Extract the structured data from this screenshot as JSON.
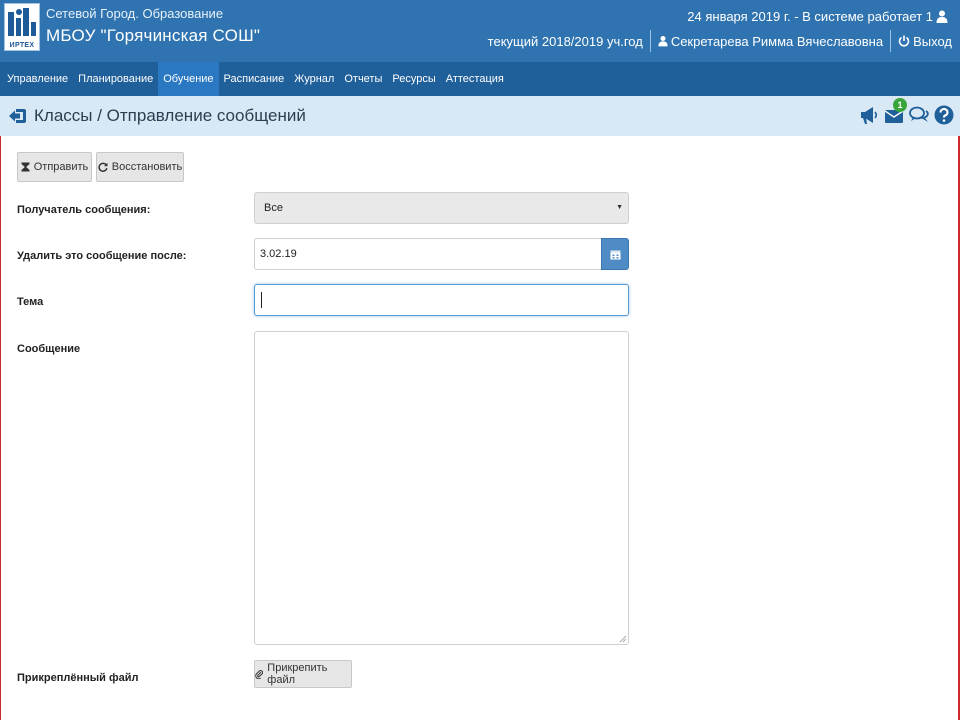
{
  "header": {
    "logo_text": "ИРТЕХ",
    "app_name": "Сетевой Город. Образование",
    "school_name": "МБОУ \"Горячинская СОШ\"",
    "date_status": "24 января 2019 г. - В системе работает 1",
    "school_year": "текущий 2018/2019 уч.год",
    "user_name": "Секретарева Римма Вячеславовна",
    "logout_label": "Выход"
  },
  "nav": {
    "items": [
      "Управление",
      "Планирование",
      "Обучение",
      "Расписание",
      "Журнал",
      "Отчеты",
      "Ресурсы",
      "Аттестация"
    ],
    "active": "Обучение"
  },
  "breadcrumb": {
    "title": "Классы / Отправление сообщений",
    "badge_count": "1"
  },
  "toolbar": {
    "send_label": "Отправить",
    "restore_label": "Восстановить"
  },
  "form": {
    "recipient_label": "Получатель сообщения:",
    "recipient_value": "Все",
    "delete_after_label": "Удалить это сообщение после:",
    "delete_after_value": "3.02.19",
    "subject_label": "Тема",
    "subject_value": "",
    "message_label": "Сообщение",
    "message_value": "",
    "attachment_label": "Прикреплённый файл",
    "attach_button_label": "Прикрепить файл"
  },
  "colors": {
    "header_bg": "#2f74b0",
    "nav_bg": "#1f5f9a",
    "nav_active": "#2a78c2",
    "crumb_bg": "#d9e8f5",
    "badge": "#3aa53a"
  },
  "icons": {
    "user": "user-icon",
    "logout": "power-icon",
    "back": "back-arrow-icon",
    "announce": "megaphone-icon",
    "mail": "envelope-icon",
    "chat": "chat-icon",
    "help": "question-icon",
    "send": "hourglass-icon",
    "restore": "refresh-icon",
    "calendar": "calendar-icon",
    "attach": "paperclip-icon"
  }
}
